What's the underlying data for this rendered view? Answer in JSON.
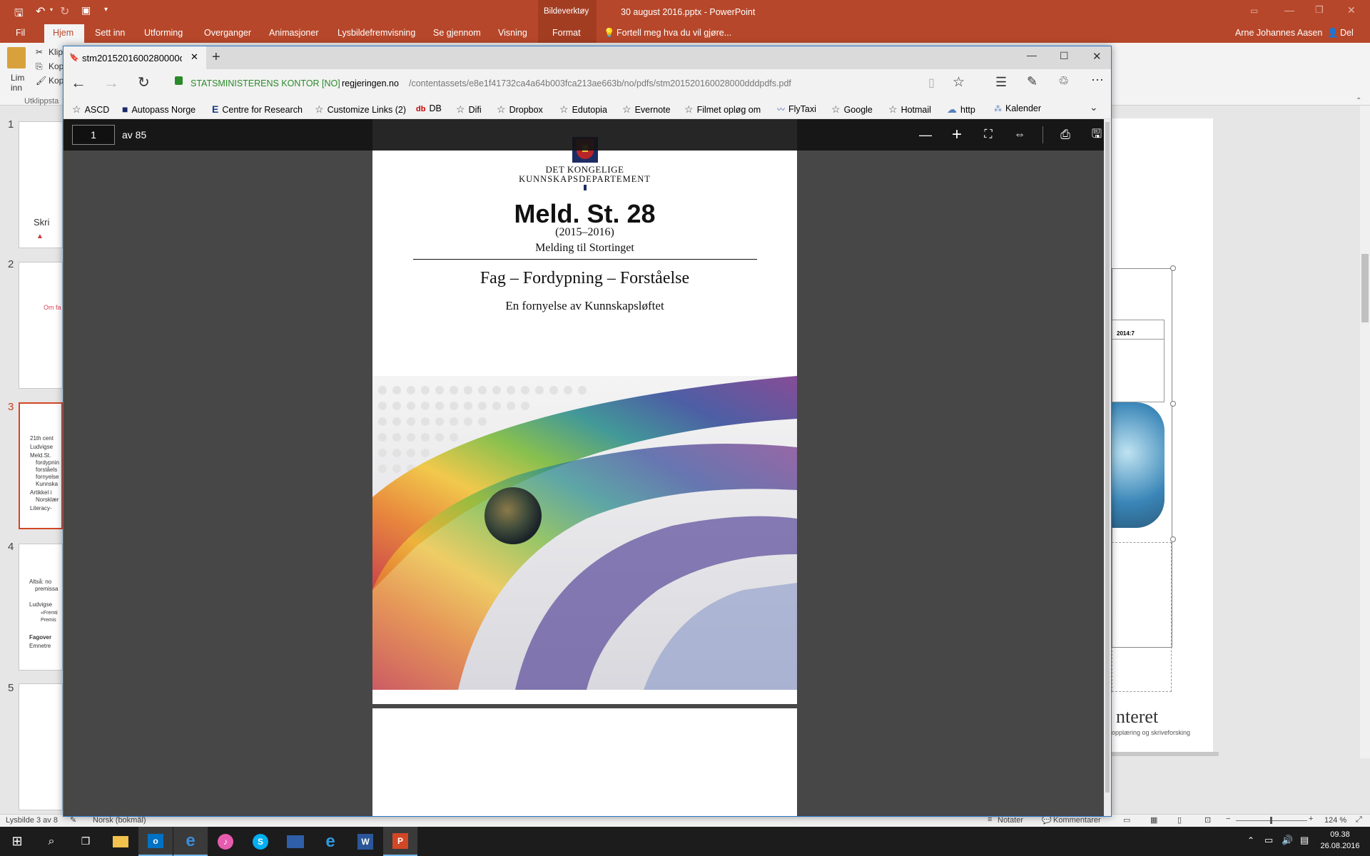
{
  "powerpoint": {
    "context_tool": "Bildeverktøy",
    "document_title": "30 august 2016.pptx - PowerPoint",
    "tabs": [
      "Fil",
      "Hjem",
      "Sett inn",
      "Utforming",
      "Overganger",
      "Animasjoner",
      "Lysbildefremvisning",
      "Se gjennom",
      "Visning",
      "Format"
    ],
    "active_tab": "Hjem",
    "tell_me": "Fortell meg hva du vil gjøre...",
    "user": "Arne Johannes Aasen",
    "share": "Del",
    "ribbon": {
      "paste_label": "Lim inn",
      "clip1": "Klip",
      "clip2": "Kop",
      "clip3": "Kop",
      "group": "Utklippsta"
    },
    "slides": [
      {
        "num": "1",
        "text": "Skri"
      },
      {
        "num": "2",
        "text": "Om fa"
      },
      {
        "num": "3",
        "lines": [
          "21th cent",
          "Ludvigse",
          "Meld.St.",
          "fordypnin",
          "forståels",
          "fornyelse",
          "Kunnska",
          "Artikkel i",
          "Norsklær",
          "Literacy-"
        ]
      },
      {
        "num": "4",
        "lines": [
          "Altså: no",
          "premissa",
          "Ludvigse",
          "«Fremti",
          "Premis",
          "Fagover",
          "Emnetre"
        ]
      },
      {
        "num": "5"
      }
    ],
    "right_pane": {
      "table_cell": "2014:7",
      "big_text": "nteret",
      "small_text": "opplæring og skriveforsking"
    },
    "status": {
      "slide": "Lysbilde 3 av 8",
      "language": "Norsk (bokmål)",
      "notes": "Notater",
      "comments": "Kommentarer",
      "zoom": "124 %"
    }
  },
  "edge": {
    "tab_title": "stm2015201600280000d",
    "security_label": "STATSMINISTERENS KONTOR [NO]",
    "url_domain": "regjeringen.no",
    "url_path": "/contentassets/e8e1f41732ca4a64b003fca213ae663b/no/pdfs/stm201520160028000dddpdfs.pdf",
    "favorites": [
      "ASCD",
      "Autopass Norge",
      "Centre for Research",
      "Customize Links (2)",
      "DB",
      "Difi",
      "Dropbox",
      "Edutopia",
      "Evernote",
      "Filmet opløg om",
      "FlyTaxi",
      "Google",
      "Hotmail",
      "http",
      "Kalender"
    ]
  },
  "pdf": {
    "page_input": "1",
    "page_total": "av 85",
    "department_line1": "DET KONGELIGE",
    "department_line2": "KUNNSKAPSDEPARTEMENT",
    "title": "Meld. St. 28",
    "years": "(2015–2016)",
    "subtitle_small": "Melding til Stortinget",
    "main_title": "Fag – Fordypning – Forståelse",
    "sub_title": "En fornyelse av Kunnskapsløftet"
  },
  "taskbar": {
    "time": "09.38",
    "date": "26.08.2016"
  }
}
